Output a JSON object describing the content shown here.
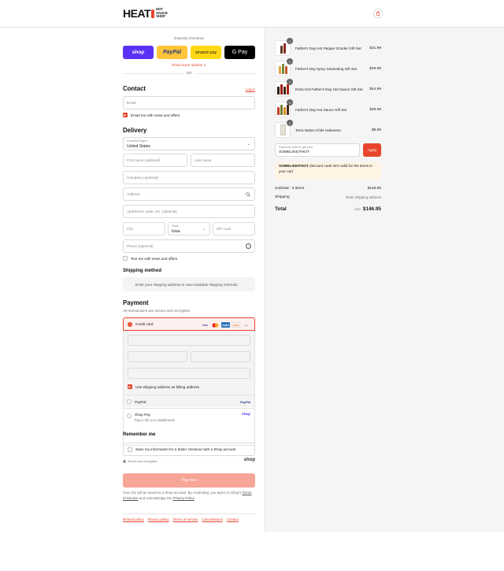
{
  "header": {
    "logo_heat": "HEAT",
    "logo_sub": [
      "HOT",
      "SAUCE",
      "SHOP"
    ],
    "cart_icon": "shopping-bag-icon"
  },
  "express": {
    "title": "Express checkout",
    "buttons": [
      "shop",
      "PayPal",
      "amazon pay",
      "G Pay"
    ],
    "show_more": "Show more options ∨",
    "or": "OR"
  },
  "contact": {
    "heading": "Contact",
    "login": "Log in",
    "email_placeholder": "Email",
    "email_news": "Email me with news and offers"
  },
  "delivery": {
    "heading": "Delivery",
    "country_label": "Country/Region",
    "country_value": "United States",
    "first_name": "First name (optional)",
    "last_name": "Last name",
    "company": "Company (optional)",
    "address": "Address",
    "apartment": "Apartment, suite, etc. (optional)",
    "city": "City",
    "state_label": "State",
    "state_value": "Iowa",
    "zip": "ZIP code",
    "phone": "Phone (optional)",
    "text_news": "Text me with news and offers"
  },
  "shipping": {
    "heading": "Shipping method",
    "note": "Enter your shipping address to view available shipping methods."
  },
  "payment": {
    "heading": "Payment",
    "subtitle": "All transactions are secure and encrypted.",
    "credit_card": "Credit card",
    "card_logos": [
      "VISA",
      "MC",
      "AMEX",
      "DISC",
      "+5"
    ],
    "billing_same": "Use shipping address as billing address",
    "paypal": "PayPal",
    "paypal_logo": "PayPal",
    "shop_pay": "Shop Pay",
    "shop_pay_sub": "Pay in full or in installments",
    "shop_pay_logo": "shop"
  },
  "remember": {
    "heading": "Remember me",
    "save": "Save my information for a faster checkout with a Shop account",
    "secure": "Secure and encrypted",
    "shop_logo": "shop"
  },
  "pay_now": "Pay now",
  "legal": {
    "text1": "Your info will be saved to a Shop account. By continuing, you agree to Shop's ",
    "tos": "Terms of Service",
    "text2": " and acknowledge the ",
    "privacy": "Privacy Policy",
    "text3": "."
  },
  "footer": [
    "Refund policy",
    "Privacy policy",
    "Terms of service",
    "Cancellations",
    "Contact"
  ],
  "order": {
    "items": [
      {
        "qty": "1",
        "name": "Father's Day Hot Pepper Grinder Gift Set",
        "price": "$31.99",
        "colors": [
          "#5b3a29",
          "#8b2b1f"
        ]
      },
      {
        "qty": "1",
        "name": "Father's Day Spicy Seasoning Gift Set",
        "price": "$29.99",
        "colors": [
          "#d9a441",
          "#7b8a3a",
          "#c2572b"
        ]
      },
      {
        "qty": "1",
        "name": "Extra Hot Father's Day Hot Sauce Gift Set",
        "price": "$44.99",
        "colors": [
          "#2a1a12",
          "#9b1c12",
          "#3b2416",
          "#b0261a"
        ]
      },
      {
        "qty": "1",
        "name": "Father's Day Hot Sauce Gift Set",
        "price": "$29.99",
        "colors": [
          "#c43a1c",
          "#6e7b2b",
          "#d88a1f",
          "#4a2a18"
        ]
      },
      {
        "qty": "1",
        "name": "Terra Nativo Chile Habanero",
        "price": "$9.99",
        "colors": [
          "#e8e1d4"
        ]
      }
    ],
    "discount_label": "Discount code or gift card",
    "discount_value": "SOMELIKEITHOT",
    "apply": "Apply",
    "warning_code": "SOMELIKEITHOT",
    "warning_text": " discount code isn't valid for the items in your cart",
    "subtotal_label": "Subtotal · 5 items",
    "subtotal_value": "$146.95",
    "shipping_label": "Shipping",
    "shipping_value": "Enter shipping address",
    "total_label": "Total",
    "currency": "USD",
    "total_value": "$146.95"
  }
}
